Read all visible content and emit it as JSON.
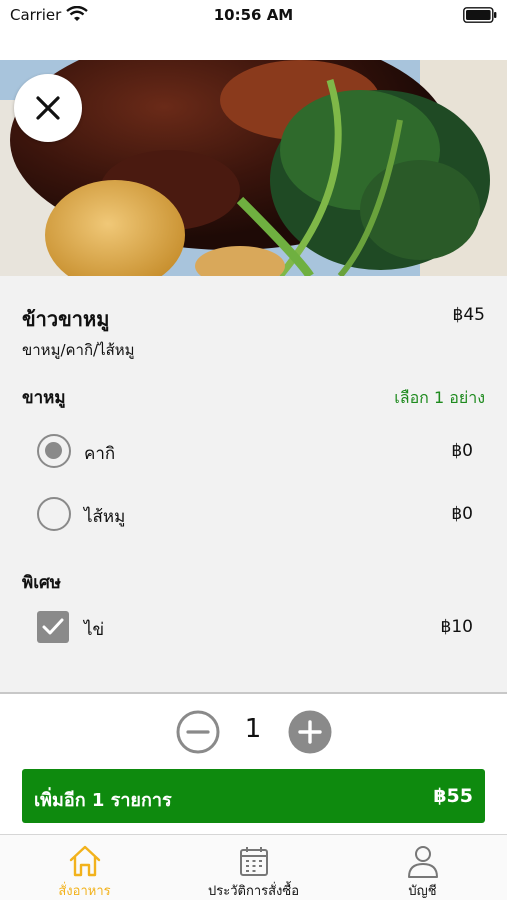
{
  "status_bar": {
    "carrier": "Carrier",
    "time": "10:56 AM"
  },
  "item": {
    "name": "ข้าวขาหมู",
    "price": "฿45",
    "description": "ขาหมู/คากิ/ไส้หมู"
  },
  "groups": [
    {
      "title": "ขาหมู",
      "rule": "เลือก 1 อย่าง",
      "options": [
        {
          "label": "คากิ",
          "price": "฿0",
          "selected": true
        },
        {
          "label": "ไส้หมู",
          "price": "฿0",
          "selected": false
        }
      ]
    },
    {
      "title": "พิเศษ",
      "options": [
        {
          "label": "ไข่",
          "price": "฿10",
          "checked": true
        }
      ]
    }
  ],
  "quantity": {
    "value": "1"
  },
  "add_button": {
    "label": "เพิ่มอีก 1 รายการ",
    "total": "฿55"
  },
  "tabs": [
    {
      "label": "สั่งอาหาร",
      "icon": "home-icon",
      "active": true
    },
    {
      "label": "ประวัติการสั่งซื้อ",
      "icon": "calendar-icon",
      "active": false
    },
    {
      "label": "บัญชี",
      "icon": "user-icon",
      "active": false
    }
  ],
  "colors": {
    "accent_green": "#0e8a0e",
    "rule_green": "#1e8a1e",
    "tab_active": "#f2b21c",
    "control_gray": "#8a8a8a"
  }
}
